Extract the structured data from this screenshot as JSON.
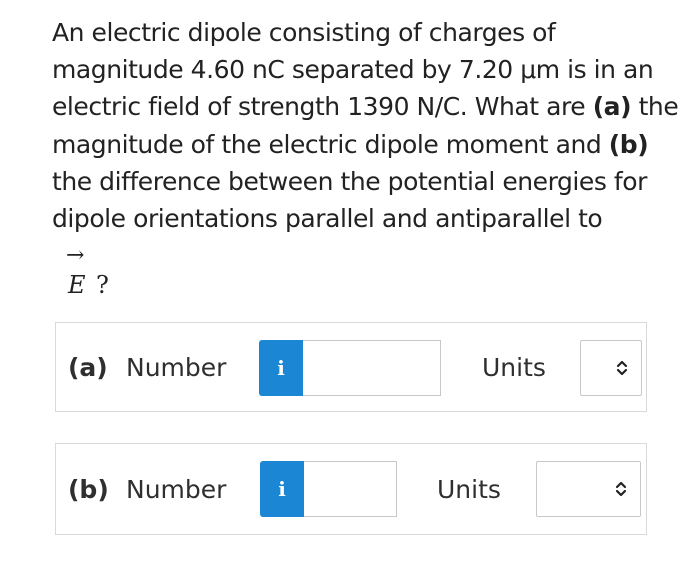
{
  "question": {
    "segment_1": "An electric dipole consisting of charges of magnitude 4.60 nC separated by 7.20 μm is in an electric field of strength 1390 N/C. What are ",
    "part_a_marker": "(a)",
    "segment_2": " the magnitude of the electric dipole moment and ",
    "part_b_marker": "(b)",
    "segment_3": " the difference between the potential energies for dipole orientations parallel and antiparallel to",
    "vector_arrow": "→",
    "vector_symbol": "E",
    "question_mark": "?"
  },
  "answers": {
    "a": {
      "part_label": "(a)",
      "number_label": "Number",
      "info_glyph": "i",
      "number_value": "",
      "units_label": "Units",
      "units_value": ""
    },
    "b": {
      "part_label": "(b)",
      "number_label": "Number",
      "info_glyph": "i",
      "number_value": "",
      "units_label": "Units",
      "units_value": ""
    }
  },
  "colors": {
    "info_button": "#1a86d4",
    "text": "#222222",
    "border": "#d9d9d9"
  },
  "icons": {
    "info": "info-icon",
    "select_toggle": "chevron-up-down-icon"
  }
}
